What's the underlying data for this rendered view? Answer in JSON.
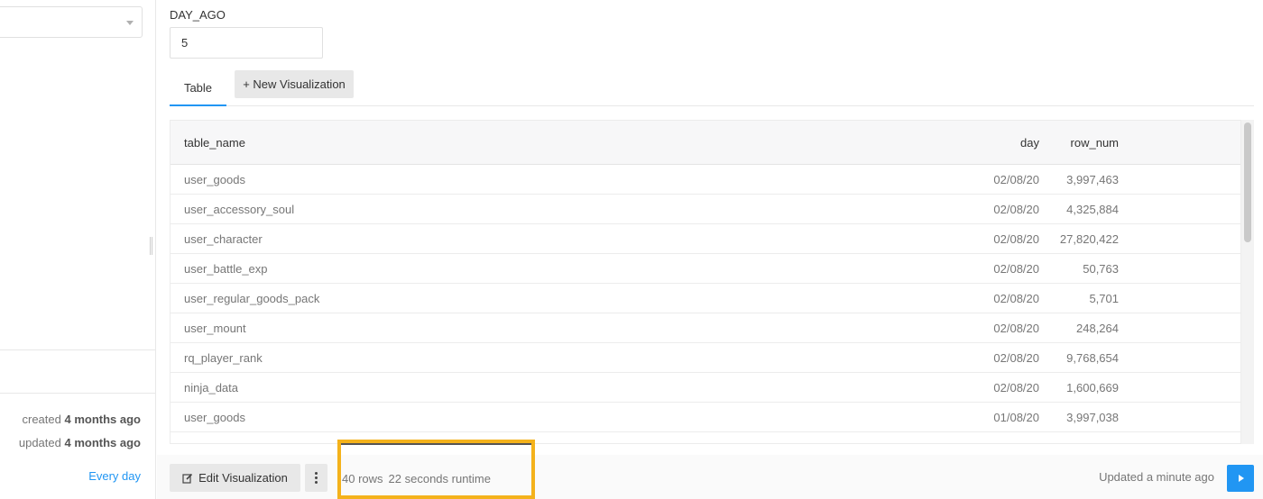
{
  "sidebar": {
    "created_prefix": "created",
    "created_when": "4 months ago",
    "updated_prefix": "updated",
    "updated_when": "4 months ago",
    "schedule_label": "Every day"
  },
  "parameters": {
    "label": "DAY_AGO",
    "value": "5"
  },
  "tabs": {
    "table_label": "Table",
    "new_visualization_label": "+ New Visualization"
  },
  "table": {
    "columns": {
      "name": "table_name",
      "day": "day",
      "row_num": "row_num"
    },
    "rows": [
      {
        "table_name": "user_goods",
        "day": "02/08/20",
        "row_num": "3,997,463"
      },
      {
        "table_name": "user_accessory_soul",
        "day": "02/08/20",
        "row_num": "4,325,884"
      },
      {
        "table_name": "user_character",
        "day": "02/08/20",
        "row_num": "27,820,422"
      },
      {
        "table_name": "user_battle_exp",
        "day": "02/08/20",
        "row_num": "50,763"
      },
      {
        "table_name": "user_regular_goods_pack",
        "day": "02/08/20",
        "row_num": "5,701"
      },
      {
        "table_name": "user_mount",
        "day": "02/08/20",
        "row_num": "248,264"
      },
      {
        "table_name": "rq_player_rank",
        "day": "02/08/20",
        "row_num": "9,768,654"
      },
      {
        "table_name": "ninja_data",
        "day": "02/08/20",
        "row_num": "1,600,669"
      },
      {
        "table_name": "user_goods",
        "day": "01/08/20",
        "row_num": "3,997,038"
      }
    ]
  },
  "footer": {
    "edit_label": "Edit Visualization",
    "rows_count": "40 rows",
    "runtime": "22 seconds runtime",
    "updated_text": "Updated a minute ago"
  },
  "colors": {
    "accent": "#2196f3",
    "highlight": "#f4b21b"
  },
  "icons": {
    "edit": "edit-icon",
    "more": "more-vertical-icon",
    "execute": "play-icon",
    "dropdown": "caret-down-icon"
  }
}
